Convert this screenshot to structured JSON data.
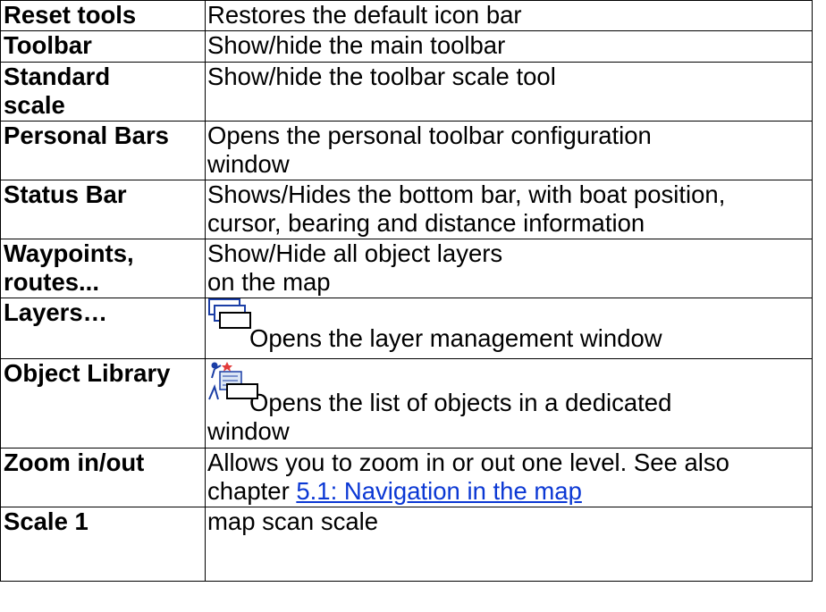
{
  "rows": [
    {
      "term": [
        "Reset tools"
      ],
      "desc": [
        "Restores the default icon bar"
      ]
    },
    {
      "term": [
        "Toolbar"
      ],
      "desc": [
        "Show/hide the main toolbar"
      ]
    },
    {
      "term": [
        "Standard",
        "scale"
      ],
      "desc": [
        "Show/hide the toolbar scale tool"
      ]
    },
    {
      "term": [
        "Personal Bars"
      ],
      "desc": [
        "Opens the personal toolbar configuration",
        "window"
      ]
    },
    {
      "term": [
        "Status Bar"
      ],
      "desc": [
        "Shows/Hides the bottom bar, with boat position,",
        "cursor, bearing and distance information"
      ]
    },
    {
      "term": [
        "Waypoints,",
        "routes..."
      ],
      "desc": [
        "Show/Hide all object layers",
        "on the map"
      ]
    },
    {
      "term": [
        "Layers…"
      ],
      "icon": "layers-icon",
      "desc": [
        "Opens the layer management window"
      ]
    },
    {
      "term": [
        "Object Library"
      ],
      "icon": "object-library-icon",
      "desc": [
        "Opens the list of objects in a dedicated",
        "window"
      ]
    },
    {
      "term": [
        "Zoom in/out"
      ],
      "desc": [
        "Allows you to zoom in or out one level. See also"
      ],
      "desc_prefix": "chapter ",
      "link": "5.1: Navigation in the map"
    },
    {
      "term": [
        "Scale 1"
      ],
      "desc": [
        "map scan scale"
      ]
    }
  ],
  "colors": {
    "border": "#000000",
    "link": "#0b38d4"
  }
}
